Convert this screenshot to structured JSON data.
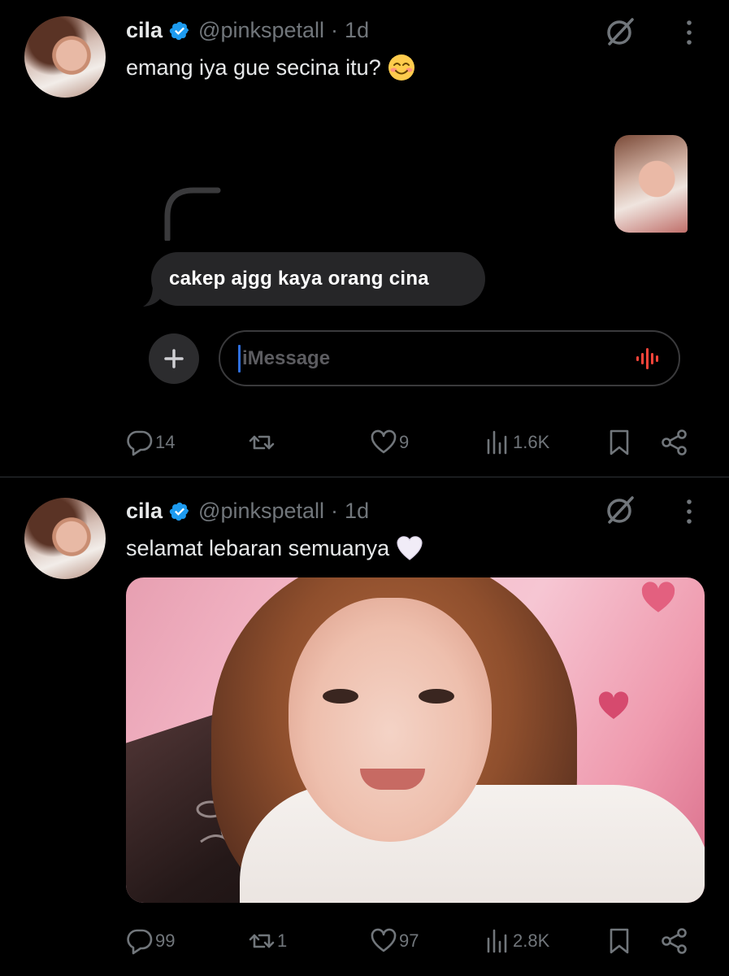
{
  "posts": [
    {
      "author": {
        "name": "cila",
        "handle": "@pinkspetall",
        "separator": "·",
        "time": "1d"
      },
      "text": "emang iya gue secina itu?",
      "embedded_chat": {
        "message": "cakep ajgg kaya orang cina",
        "input_placeholder": "iMessage"
      },
      "stats": {
        "replies": "14",
        "reposts": "",
        "likes": "9",
        "views": "1.6K"
      }
    },
    {
      "author": {
        "name": "cila",
        "handle": "@pinkspetall",
        "separator": "·",
        "time": "1d"
      },
      "text": "selamat lebaran semuanya",
      "stats": {
        "replies": "99",
        "reposts": "1",
        "likes": "97",
        "views": "2.8K"
      }
    }
  ],
  "icons": {
    "verified": "verified-badge-icon",
    "grok": "grok-icon",
    "more": "more-vertical-icon",
    "reply": "reply-icon",
    "repost": "repost-icon",
    "like": "heart-icon",
    "views": "views-icon",
    "bookmark": "bookmark-icon",
    "share": "share-icon",
    "smile_emoji": "smiling-face-emoji",
    "heart_emoji": "white-heart-emoji"
  },
  "colors": {
    "background": "#000000",
    "text_primary": "#e7e9ea",
    "text_secondary": "#71767b",
    "verified_blue": "#1d9bf0",
    "divider": "#2f3336",
    "chat_bubble": "#262628",
    "audio_red": "#ff453a"
  }
}
